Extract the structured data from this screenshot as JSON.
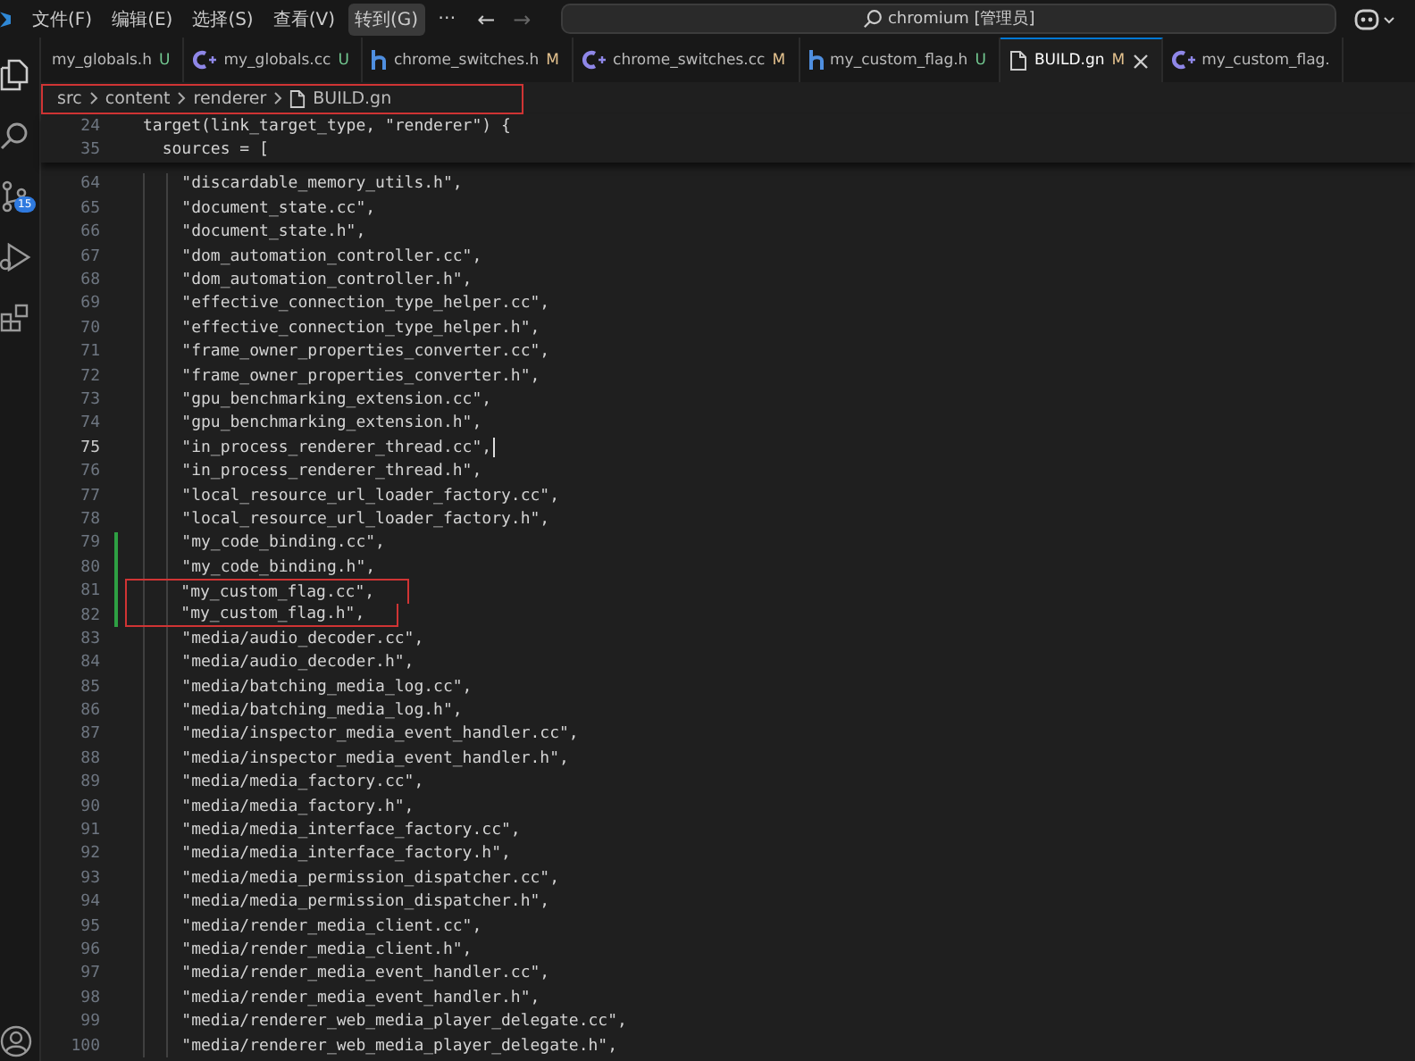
{
  "title_bar": {
    "menus": [
      {
        "label": "文件(F)",
        "selected": false
      },
      {
        "label": "编辑(E)",
        "selected": false
      },
      {
        "label": "选择(S)",
        "selected": false
      },
      {
        "label": "查看(V)",
        "selected": false
      },
      {
        "label": "转到(G)",
        "selected": true
      }
    ],
    "more": "⋯",
    "back": "←",
    "forward": "→",
    "search": "chromium [管理员]"
  },
  "activity_bar": {
    "items": [
      {
        "kind": "explorer"
      },
      {
        "kind": "search"
      },
      {
        "kind": "scm",
        "badge": "15"
      },
      {
        "kind": "run"
      },
      {
        "kind": "extensions"
      }
    ]
  },
  "tabs": [
    {
      "label": "my_globals.h",
      "status": "U",
      "kind": "none",
      "selected": false
    },
    {
      "label": "my_globals.cc",
      "status": "U",
      "kind": "cpp",
      "selected": false
    },
    {
      "label": "chrome_switches.h",
      "status": "M",
      "kind": "header",
      "selected": false
    },
    {
      "label": "chrome_switches.cc",
      "status": "M",
      "kind": "cpp",
      "selected": false
    },
    {
      "label": "my_custom_flag.h",
      "status": "U",
      "kind": "header",
      "selected": false
    },
    {
      "label": "BUILD.gn",
      "status": "M",
      "kind": "file",
      "selected": true
    },
    {
      "label": "my_custom_flag.",
      "kind": "cpp",
      "selected": false
    }
  ],
  "breadcrumb": {
    "items": [
      "src",
      "content",
      "renderer",
      "BUILD.gn"
    ],
    "boxed": true
  },
  "sticky_lines": [
    {
      "number": "24",
      "text": "target(link_target_type, \"renderer\") {"
    },
    {
      "number": "35",
      "text": "  sources = ["
    }
  ],
  "lines": [
    {
      "number": "64",
      "text": "    \"discardable_memory_utils.h\",",
      "added": false,
      "boxed": false,
      "current": false
    },
    {
      "number": "65",
      "text": "    \"document_state.cc\",",
      "added": false,
      "boxed": false,
      "current": false
    },
    {
      "number": "66",
      "text": "    \"document_state.h\",",
      "added": false,
      "boxed": false,
      "current": false
    },
    {
      "number": "67",
      "text": "    \"dom_automation_controller.cc\",",
      "added": false,
      "boxed": false,
      "current": false
    },
    {
      "number": "68",
      "text": "    \"dom_automation_controller.h\",",
      "added": false,
      "boxed": false,
      "current": false
    },
    {
      "number": "69",
      "text": "    \"effective_connection_type_helper.cc\",",
      "added": false,
      "boxed": false,
      "current": false
    },
    {
      "number": "70",
      "text": "    \"effective_connection_type_helper.h\",",
      "added": false,
      "boxed": false,
      "current": false
    },
    {
      "number": "71",
      "text": "    \"frame_owner_properties_converter.cc\",",
      "added": false,
      "boxed": false,
      "current": false
    },
    {
      "number": "72",
      "text": "    \"frame_owner_properties_converter.h\",",
      "added": false,
      "boxed": false,
      "current": false
    },
    {
      "number": "73",
      "text": "    \"gpu_benchmarking_extension.cc\",",
      "added": false,
      "boxed": false,
      "current": false
    },
    {
      "number": "74",
      "text": "    \"gpu_benchmarking_extension.h\",",
      "added": false,
      "boxed": false,
      "current": false
    },
    {
      "number": "75",
      "text": "    \"in_process_renderer_thread.cc\",",
      "added": false,
      "boxed": false,
      "current": true
    },
    {
      "number": "76",
      "text": "    \"in_process_renderer_thread.h\",",
      "added": false,
      "boxed": false,
      "current": false
    },
    {
      "number": "77",
      "text": "    \"local_resource_url_loader_factory.cc\",",
      "added": false,
      "boxed": false,
      "current": false
    },
    {
      "number": "78",
      "text": "    \"local_resource_url_loader_factory.h\",",
      "added": false,
      "boxed": false,
      "current": false
    },
    {
      "number": "79",
      "text": "    \"my_code_binding.cc\",",
      "added": true,
      "boxed": false,
      "current": false
    },
    {
      "number": "80",
      "text": "    \"my_code_binding.h\",",
      "added": true,
      "boxed": false,
      "current": false
    },
    {
      "number": "81",
      "text": "    \"my_custom_flag.cc\",",
      "added": true,
      "boxed": true,
      "current": false
    },
    {
      "number": "82",
      "text": "    \"my_custom_flag.h\",",
      "added": true,
      "boxed": true,
      "current": false
    },
    {
      "number": "83",
      "text": "    \"media/audio_decoder.cc\",",
      "added": false,
      "boxed": false,
      "current": false
    },
    {
      "number": "84",
      "text": "    \"media/audio_decoder.h\",",
      "added": false,
      "boxed": false,
      "current": false
    },
    {
      "number": "85",
      "text": "    \"media/batching_media_log.cc\",",
      "added": false,
      "boxed": false,
      "current": false
    },
    {
      "number": "86",
      "text": "    \"media/batching_media_log.h\",",
      "added": false,
      "boxed": false,
      "current": false
    },
    {
      "number": "87",
      "text": "    \"media/inspector_media_event_handler.cc\",",
      "added": false,
      "boxed": false,
      "current": false
    },
    {
      "number": "88",
      "text": "    \"media/inspector_media_event_handler.h\",",
      "added": false,
      "boxed": false,
      "current": false
    },
    {
      "number": "89",
      "text": "    \"media/media_factory.cc\",",
      "added": false,
      "boxed": false,
      "current": false
    },
    {
      "number": "90",
      "text": "    \"media/media_factory.h\",",
      "added": false,
      "boxed": false,
      "current": false
    },
    {
      "number": "91",
      "text": "    \"media/media_interface_factory.cc\",",
      "added": false,
      "boxed": false,
      "current": false
    },
    {
      "number": "92",
      "text": "    \"media/media_interface_factory.h\",",
      "added": false,
      "boxed": false,
      "current": false
    },
    {
      "number": "93",
      "text": "    \"media/media_permission_dispatcher.cc\",",
      "added": false,
      "boxed": false,
      "current": false
    },
    {
      "number": "94",
      "text": "    \"media/media_permission_dispatcher.h\",",
      "added": false,
      "boxed": false,
      "current": false
    },
    {
      "number": "95",
      "text": "    \"media/render_media_client.cc\",",
      "added": false,
      "boxed": false,
      "current": false
    },
    {
      "number": "96",
      "text": "    \"media/render_media_client.h\",",
      "added": false,
      "boxed": false,
      "current": false
    },
    {
      "number": "97",
      "text": "    \"media/render_media_event_handler.cc\",",
      "added": false,
      "boxed": false,
      "current": false
    },
    {
      "number": "98",
      "text": "    \"media/render_media_event_handler.h\",",
      "added": false,
      "boxed": false,
      "current": false
    },
    {
      "number": "99",
      "text": "    \"media/renderer_web_media_player_delegate.cc\",",
      "added": false,
      "boxed": false,
      "current": false
    },
    {
      "number": "100",
      "text": "    \"media/renderer_web_media_player_delegate.h\",",
      "added": false,
      "boxed": false,
      "current": false
    }
  ]
}
